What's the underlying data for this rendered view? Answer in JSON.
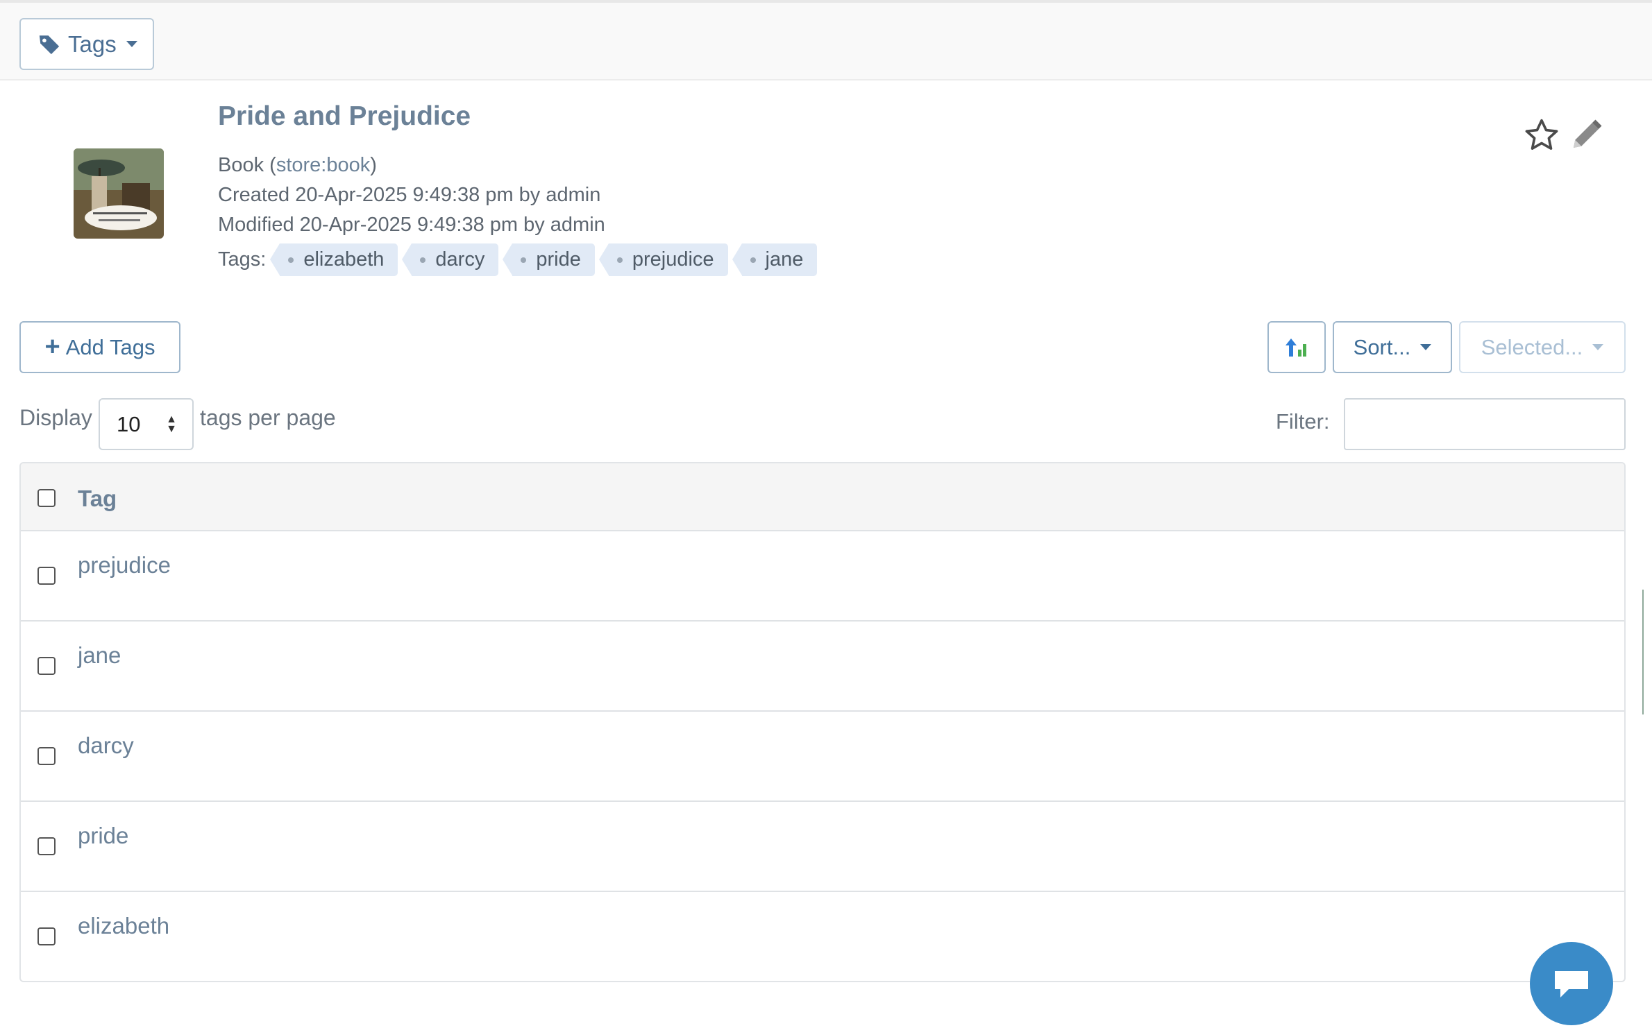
{
  "toolbar": {
    "tags_label": "Tags"
  },
  "item": {
    "title": "Pride and Prejudice",
    "type_prefix": "Book (",
    "type_link": "store:book",
    "type_suffix": ")",
    "created": "Created 20-Apr-2025 9:49:38 pm by admin",
    "modified": "Modified 20-Apr-2025 9:49:38 pm by admin",
    "tags_label": "Tags:",
    "tags": [
      "elizabeth",
      "darcy",
      "pride",
      "prejudice",
      "jane"
    ]
  },
  "actions": {
    "add_tags": "Add Tags",
    "sort": "Sort...",
    "selected": "Selected..."
  },
  "paging": {
    "display_label": "Display",
    "per_page_value": "10",
    "per_page_suffix": "tags per page",
    "filter_label": "Filter:",
    "filter_value": ""
  },
  "table": {
    "header": "Tag",
    "rows": [
      "prejudice",
      "jane",
      "darcy",
      "pride",
      "elizabeth"
    ]
  },
  "colors": {
    "accent": "#3f6e98",
    "chip_bg": "#e1eaf6",
    "chat_bg": "#3a8bc8"
  }
}
